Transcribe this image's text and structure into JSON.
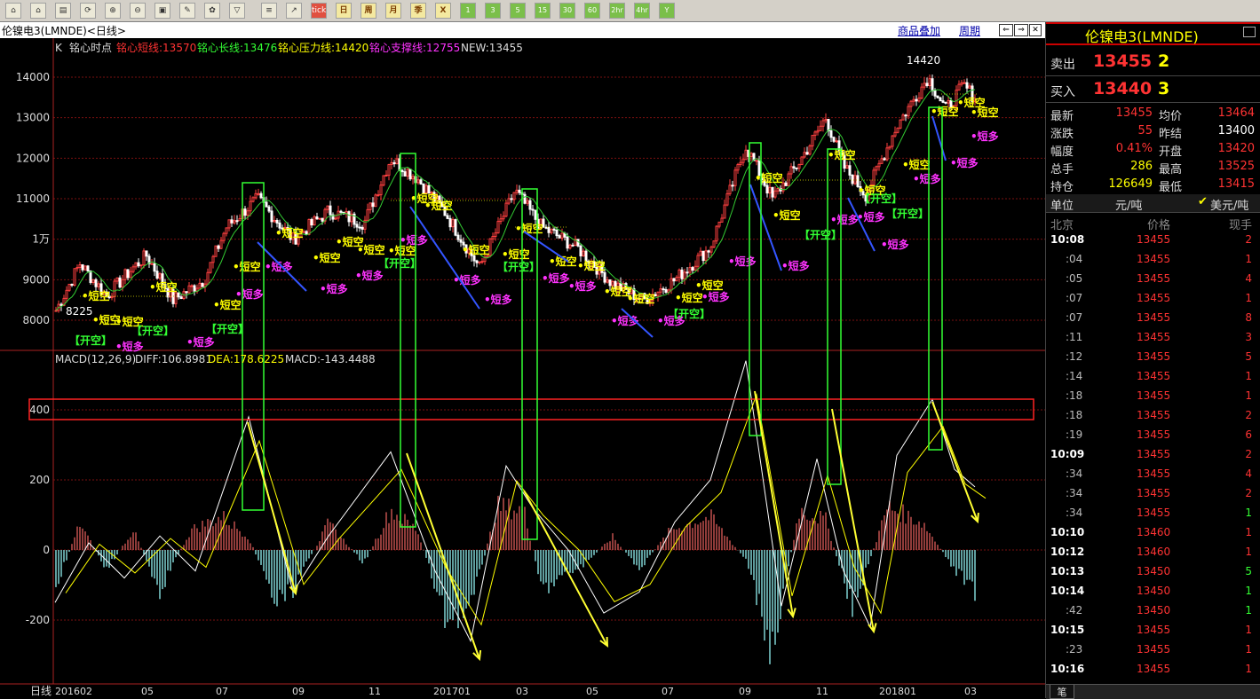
{
  "toolbar": {
    "icons": [
      "home-icon",
      "house-icon",
      "folder-icon",
      "refresh-icon",
      "zoom-in-icon",
      "zoom-out-icon",
      "window-icon",
      "pen-icon",
      "paint-icon",
      "filter-icon",
      "list-icon",
      "trend-icon"
    ],
    "tick_label": "tick",
    "periods": [
      "日",
      "周",
      "月",
      "季",
      "X"
    ],
    "minutes": [
      "1",
      "3",
      "5",
      "15",
      "30",
      "60",
      "2hr",
      "4hr",
      "Y"
    ]
  },
  "chart": {
    "window_title": "伦镍电3(LMNDE)<日线>",
    "links": [
      "商品叠加",
      "周期"
    ],
    "indicator_line": {
      "k": "K",
      "name": "铭心时点",
      "short_line": "铭心短线:13570",
      "long_line": "铭心长线:13476",
      "pressure": "铭心压力线:14420",
      "support": "铭心支撑线:12755",
      "new": "NEW:13455"
    },
    "y_ticks": [
      "14000",
      "13000",
      "12000",
      "11000",
      "1万",
      "9000",
      "8000"
    ],
    "price_high": "14420",
    "price_low": "8225",
    "macd_line": {
      "name": "MACD(12,26,9)",
      "diff": "DIFF:106.8981",
      "dea": "DEA:178.6225",
      "macd": "MACD:-143.4488"
    },
    "macd_ticks": [
      "400",
      "200",
      "0",
      "-200"
    ],
    "x_label": "日线",
    "x_ticks": [
      "201602",
      "05",
      "07",
      "09",
      "11",
      "201701",
      "03",
      "05",
      "07",
      "09",
      "11",
      "201801",
      "03"
    ],
    "signals": {
      "short": "短空",
      "long": "短多",
      "open_short": "【开空】"
    }
  },
  "quote": {
    "title": "伦镍电3(LMNDE)",
    "sell_label": "卖出",
    "sell_price": "13455",
    "sell_vol": "2",
    "buy_label": "买入",
    "buy_price": "13440",
    "buy_vol": "3",
    "stats": [
      {
        "l1": "最新",
        "v1": "13455",
        "l2": "均价",
        "v2": "13464"
      },
      {
        "l1": "涨跌",
        "v1": "55",
        "l2": "昨结",
        "v2": "13400"
      },
      {
        "l1": "幅度",
        "v1": "0.41%",
        "l2": "开盘",
        "v2": "13420"
      },
      {
        "l1": "总手",
        "v1": "286",
        "l2": "最高",
        "v2": "13525"
      },
      {
        "l1": "持仓",
        "v1": "126649",
        "l2": "最低",
        "v2": "13415"
      }
    ],
    "unit_label": "单位",
    "unit_cny": "元/吨",
    "unit_usd": "美元/吨",
    "ticks_header": {
      "time": "北京",
      "price": "价格",
      "vol": "现手"
    },
    "ticks": [
      {
        "time": "10:08",
        "price": "13455",
        "vol": "2",
        "major": true,
        "color": "red"
      },
      {
        "time": ":04",
        "price": "13455",
        "vol": "1",
        "major": false,
        "color": "red"
      },
      {
        "time": ":05",
        "price": "13455",
        "vol": "4",
        "major": false,
        "color": "red"
      },
      {
        "time": ":07",
        "price": "13455",
        "vol": "1",
        "major": false,
        "color": "red"
      },
      {
        "time": ":07",
        "price": "13455",
        "vol": "8",
        "major": false,
        "color": "red"
      },
      {
        "time": ":11",
        "price": "13455",
        "vol": "3",
        "major": false,
        "color": "red"
      },
      {
        "time": ":12",
        "price": "13455",
        "vol": "5",
        "major": false,
        "color": "red"
      },
      {
        "time": ":14",
        "price": "13455",
        "vol": "1",
        "major": false,
        "color": "red"
      },
      {
        "time": ":18",
        "price": "13455",
        "vol": "1",
        "major": false,
        "color": "red"
      },
      {
        "time": ":18",
        "price": "13455",
        "vol": "2",
        "major": false,
        "color": "red"
      },
      {
        "time": ":19",
        "price": "13455",
        "vol": "6",
        "major": false,
        "color": "red"
      },
      {
        "time": "10:09",
        "price": "13455",
        "vol": "2",
        "major": true,
        "color": "red"
      },
      {
        "time": ":34",
        "price": "13455",
        "vol": "4",
        "major": false,
        "color": "red"
      },
      {
        "time": ":34",
        "price": "13455",
        "vol": "2",
        "major": false,
        "color": "red"
      },
      {
        "time": ":34",
        "price": "13455",
        "vol": "1",
        "major": false,
        "color": "green"
      },
      {
        "time": "10:10",
        "price": "13460",
        "vol": "1",
        "major": true,
        "color": "red"
      },
      {
        "time": "10:12",
        "price": "13460",
        "vol": "1",
        "major": true,
        "color": "red"
      },
      {
        "time": "10:13",
        "price": "13450",
        "vol": "5",
        "major": true,
        "color": "green"
      },
      {
        "time": "10:14",
        "price": "13450",
        "vol": "1",
        "major": true,
        "color": "green"
      },
      {
        "time": ":42",
        "price": "13450",
        "vol": "1",
        "major": false,
        "color": "green"
      },
      {
        "time": "10:15",
        "price": "13455",
        "vol": "1",
        "major": true,
        "color": "red"
      },
      {
        "time": ":23",
        "price": "13455",
        "vol": "1",
        "major": false,
        "color": "red"
      },
      {
        "time": "10:16",
        "price": "13455",
        "vol": "1",
        "major": true,
        "color": "red"
      }
    ],
    "footer_tab": "笔"
  },
  "colors": {
    "up": "#ff3333",
    "down": "#33ff33",
    "signal_short": "#ffff00",
    "signal_long": "#ff33ff",
    "box": "#33ff33",
    "macd_pos": "#c0504d",
    "macd_neg": "#7fd3d3"
  }
}
